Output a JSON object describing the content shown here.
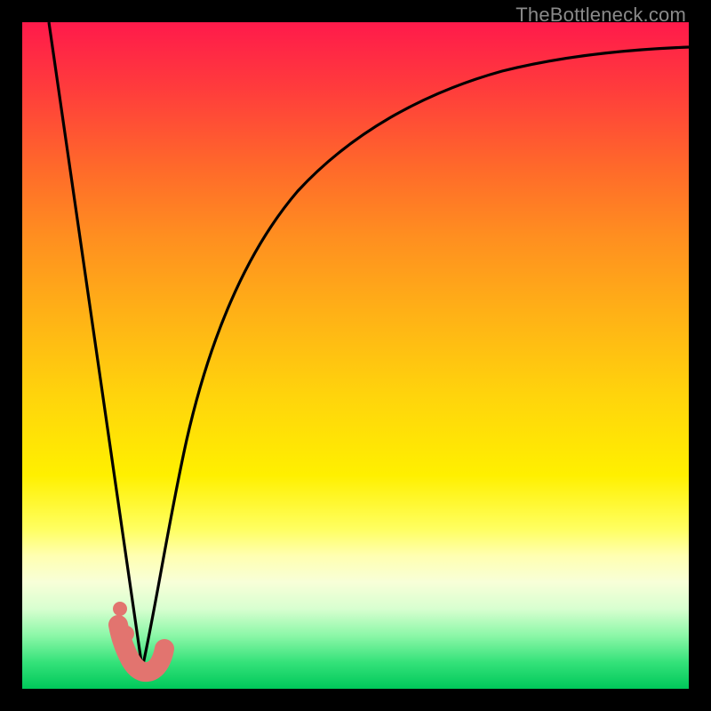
{
  "watermark": "TheBottleneck.com",
  "chart_data": {
    "type": "line",
    "title": "",
    "xlabel": "",
    "ylabel": "",
    "xlim": [
      0,
      100
    ],
    "ylim": [
      0,
      100
    ],
    "series": [
      {
        "name": "left-edge-descent",
        "x": [
          4,
          18
        ],
        "values": [
          100,
          3
        ]
      },
      {
        "name": "recovery-curve",
        "x": [
          18,
          20,
          24,
          28,
          34,
          42,
          52,
          64,
          78,
          90,
          100
        ],
        "values": [
          3,
          10,
          30,
          46,
          60,
          72,
          82,
          89,
          93,
          95,
          96
        ]
      },
      {
        "name": "valley-marker",
        "x": [
          15,
          16.5,
          18,
          19.3,
          20.5,
          21.5
        ],
        "values": [
          10,
          6,
          3,
          3,
          3.5,
          5
        ]
      }
    ],
    "background_gradient": {
      "top": "#ff1a4b",
      "mid": "#ffd40c",
      "bottom": "#00c85a"
    },
    "curve_color": "#000000",
    "marker_color": "#e2746f"
  }
}
